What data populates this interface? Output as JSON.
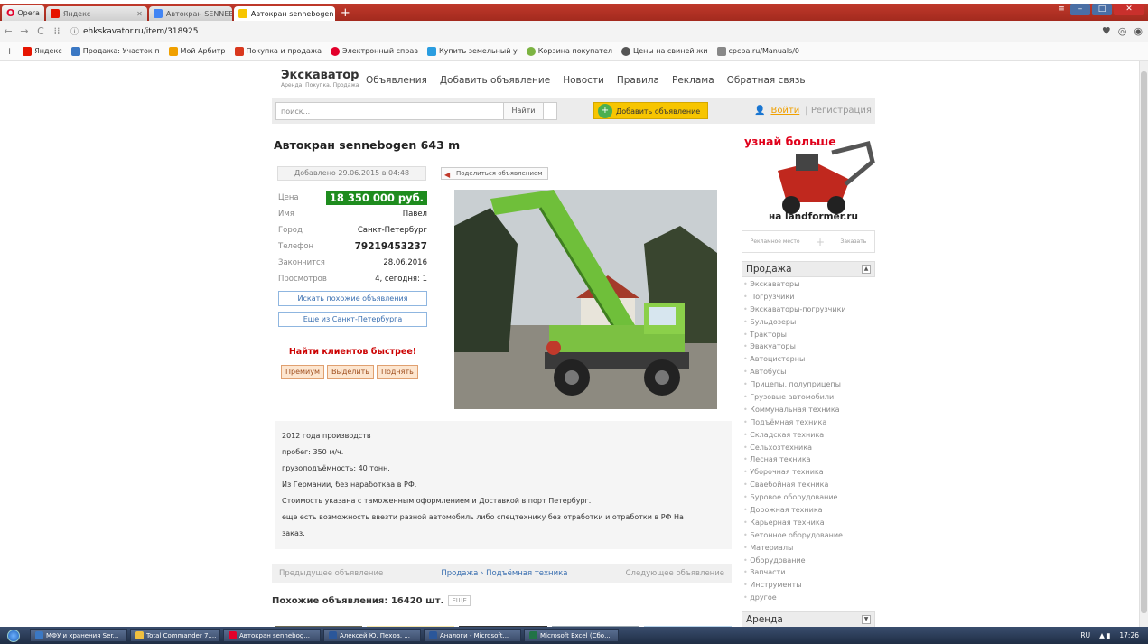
{
  "browser": {
    "opera_label": "Opera",
    "tabs": [
      {
        "label": "Яндекс",
        "color": "#e61400",
        "active": false
      },
      {
        "label": "Автокран SENNEBOGEN",
        "color": "#4285f4",
        "active": false
      },
      {
        "label": "Автокран sennebogen 64",
        "color": "#f7c500",
        "active": true
      }
    ],
    "url": "ehkskavator.ru/item/318925",
    "bookmarks": [
      {
        "label": "Яндекс",
        "color": "#e61400"
      },
      {
        "label": "Продажа: Участок п",
        "color": "#3b78c4"
      },
      {
        "label": "Мой Арбитр",
        "color": "#f0a000"
      },
      {
        "label": "Покупка и продажа",
        "color": "#d9381e"
      },
      {
        "label": "Электронный справ",
        "color": "#e3002b"
      },
      {
        "label": "Купить земельный у",
        "color": "#2a9de0"
      },
      {
        "label": "Корзина покупател",
        "color": "#7cb342"
      },
      {
        "label": "Цены на свиней жи",
        "color": "#555555"
      },
      {
        "label": "cpcpa.ru/Manuals/0",
        "color": "#888888"
      }
    ]
  },
  "site": {
    "logo_title": "Экскаватор",
    "logo_sub": "Аренда. Покупка. Продажа",
    "nav": [
      "Объявления",
      "Добавить объявление",
      "Новости",
      "Правила",
      "Реклама",
      "Обратная связь"
    ],
    "search_placeholder": "поиск...",
    "search_button": "Найти",
    "add_button": "Добавить объявление",
    "login": "Войти",
    "register": "| Регистрация"
  },
  "listing": {
    "title": "Автокран sennebogen 643 m",
    "added": "Добавлено 29.06.2015 в 04:48",
    "share": "Поделиться объявлением",
    "fields": [
      {
        "key": "Цена",
        "value": "18 350 000 руб."
      },
      {
        "key": "Имя",
        "value": "Павел"
      },
      {
        "key": "Город",
        "value": "Санкт-Петербург"
      },
      {
        "key": "Телефон",
        "value": "79219453237"
      },
      {
        "key": "Закончится",
        "value": "28.06.2016"
      },
      {
        "key": "Просмотров",
        "value": "4, сегодня: 1"
      }
    ],
    "find_similar": "Искать похожие объявления",
    "more_city": "Еще из Санкт-Петербурга",
    "fast_title": "Найти клиентов быстрее!",
    "promo": [
      "Премиум",
      "Выделить",
      "Поднять"
    ],
    "description": [
      "2012 года производств",
      "пробег: 350 м/ч.",
      "грузоподъёмность: 40 тонн.",
      "Из Германии, без наработкаа в РФ.",
      "Стоимость указана с таможенным оформлением и Доставкой в порт Петербург.",
      "еще есть возможность ввезти разной автомобиль либо спецтехнику без отработки и отработки в РФ На",
      "заказ."
    ],
    "prev": "Предыдущее объявление",
    "crumb": "Продажа › Подъёмная техника",
    "next": "Следующее объявление",
    "similar_label": "Похожие объявления: 16420 шт.",
    "similar_more": "ЕЩЕ"
  },
  "sidebar": {
    "ad_headline": "узнай больше",
    "ad_footer": "на landformer.ru",
    "ad_place": "Рекламное место",
    "ad_order": "Заказать",
    "category_title": "Продажа",
    "categories": [
      "Экскаваторы",
      "Погрузчики",
      "Экскаваторы-погрузчики",
      "Бульдозеры",
      "Тракторы",
      "Эвакуаторы",
      "Автоцистерны",
      "Автобусы",
      "Прицепы, полуприцепы",
      "Грузовые автомобили",
      "Коммунальная техника",
      "Подъёмная техника",
      "Складская техника",
      "Сельхозтехника",
      "Лесная техника",
      "Уборочная техника",
      "Сваебойная техника",
      "Буровое оборудование",
      "Дорожная техника",
      "Карьерная техника",
      "Бетонное оборудование",
      "Материалы",
      "Оборудование",
      "Запчасти",
      "Инструменты",
      "другое"
    ],
    "category2_title": "Аренда"
  },
  "taskbar": {
    "items": [
      {
        "label": "МФУ и хранения Ser...",
        "color": "#3b78c4"
      },
      {
        "label": "Total Commander 7....",
        "color": "#f0c040"
      },
      {
        "label": "Автокран sennebog...",
        "color": "#e3002b"
      },
      {
        "label": "Алексей Ю. Пехов. ...",
        "color": "#2b579a"
      },
      {
        "label": "Аналоги - Microsoft...",
        "color": "#2b579a"
      },
      {
        "label": "Microsoft Excel (Сбо...",
        "color": "#217346"
      }
    ],
    "lang": "RU",
    "time": "17:26"
  }
}
